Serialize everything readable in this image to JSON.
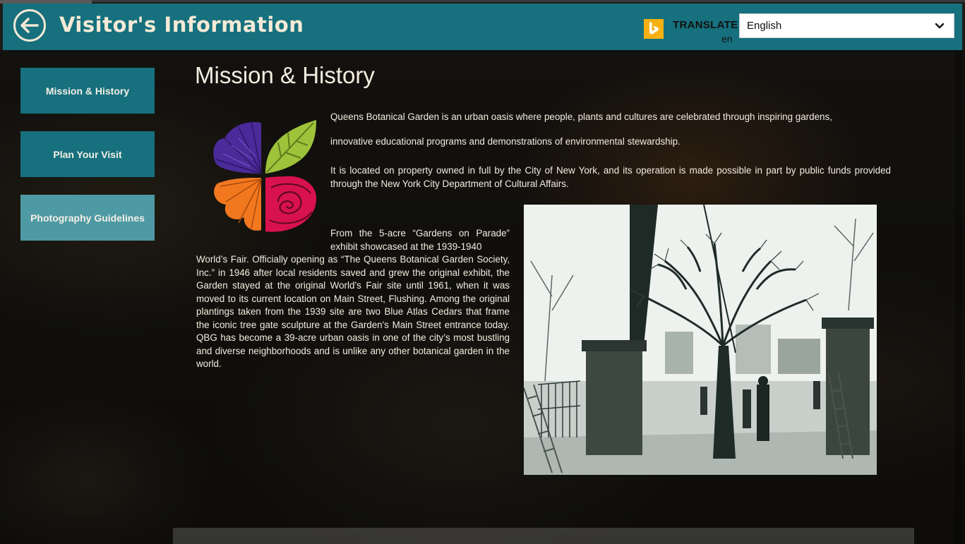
{
  "app": {
    "title": "Visitor's Information"
  },
  "translate": {
    "label": "TRANSLATE",
    "code": "en",
    "selected_language": "English"
  },
  "sidebar": {
    "items": [
      {
        "label": "Mission & History"
      },
      {
        "label": "Plan Your Visit"
      },
      {
        "label": "Photography Guidelines"
      }
    ]
  },
  "content": {
    "heading": "Mission & History",
    "paragraph1": "Queens Botanical Garden is an urban oasis where people, plants and cultures are celebrated through inspiring gardens,",
    "paragraph1b": "innovative educational programs and demonstrations of environmental stewardship.",
    "paragraph2": "It is located on property owned in full by the City of New York, and its operation is made possible in part by public funds provided through the New York City Department of Cultural Affairs.",
    "paragraph3a": "From the 5-acre “Gardens on Parade” exhibit showcased at the 1939-1940",
    "paragraph3b": "World’s Fair. Officially opening as “The Queens Botanical Garden Society, Inc.” in 1946 after local residents saved and grew the original exhibit, the Garden stayed at the original World’s Fair site until 1961, when it was moved to its current location on Main Street, Flushing. Among the original plantings taken from the 1939 site are two Blue Atlas Cedars that frame the iconic tree gate sculpture at the Garden's Main Street entrance today. QBG has become a 39-acre urban oasis in one of the city’s most bustling and diverse neighborhoods and is unlike any other botanical garden in the world."
  },
  "colors": {
    "header": "#16707d",
    "button": "#16707d",
    "button_active": "#4e9aa4",
    "bing": "#f6b012"
  },
  "icons": [
    "back-arrow-icon",
    "bing-icon",
    "chevron-down-icon"
  ]
}
